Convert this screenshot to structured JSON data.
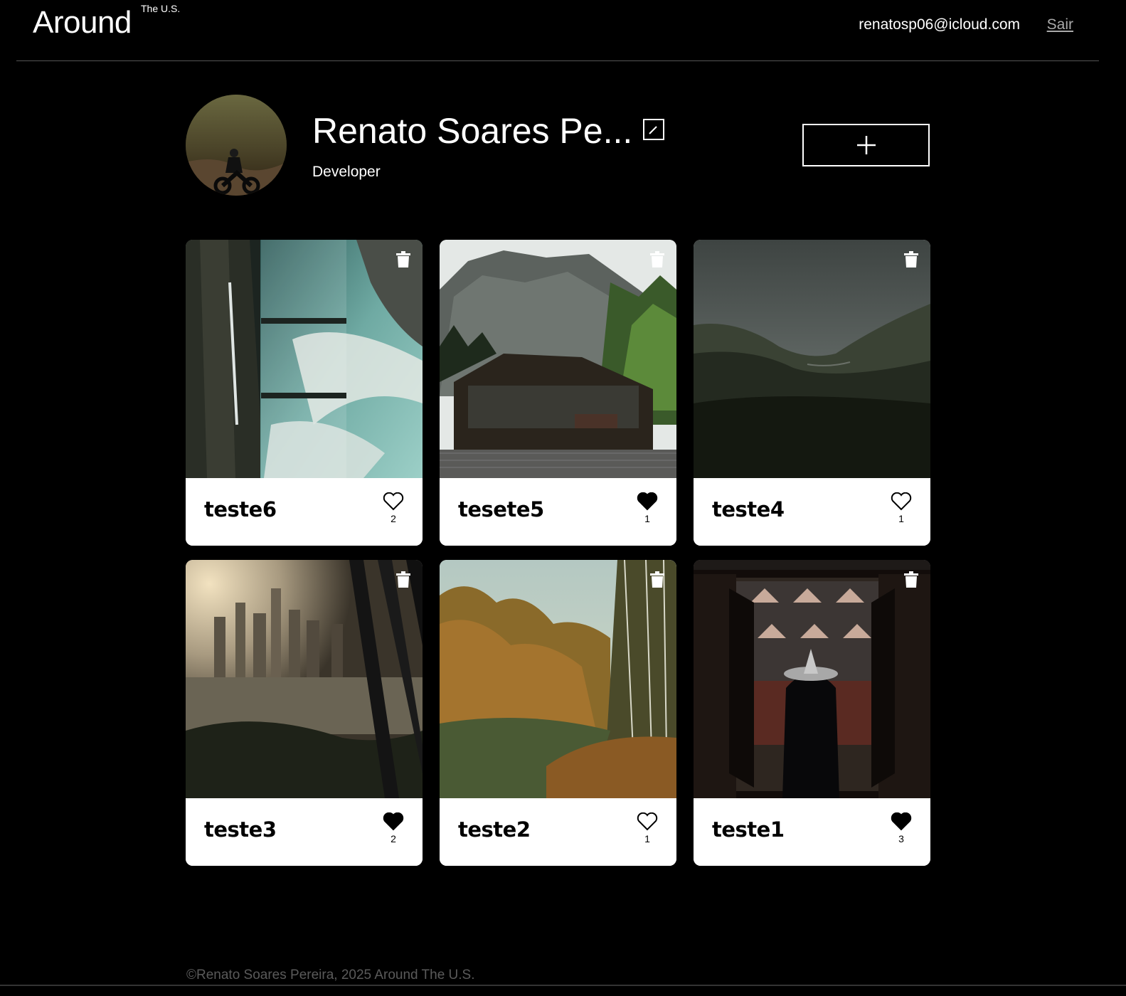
{
  "header": {
    "logo": "Around",
    "logo_sup": "The U.S.",
    "user_email": "renatosp06@icloud.com",
    "logout_label": "Sair"
  },
  "profile": {
    "name": "Renato Soares Pe...",
    "role": "Developer",
    "edit_icon": "pencil-icon",
    "add_icon": "plus-icon"
  },
  "cards": [
    {
      "title": "teste6",
      "likes": "2",
      "liked": false
    },
    {
      "title": "tesete5",
      "likes": "1",
      "liked": true
    },
    {
      "title": "teste4",
      "likes": "1",
      "liked": false
    },
    {
      "title": "teste3",
      "likes": "2",
      "liked": true
    },
    {
      "title": "teste2",
      "likes": "1",
      "liked": false
    },
    {
      "title": "teste1",
      "likes": "3",
      "liked": true
    }
  ],
  "footer": {
    "copyright": "©Renato Soares Pereira, 2025 Around The U.S."
  }
}
